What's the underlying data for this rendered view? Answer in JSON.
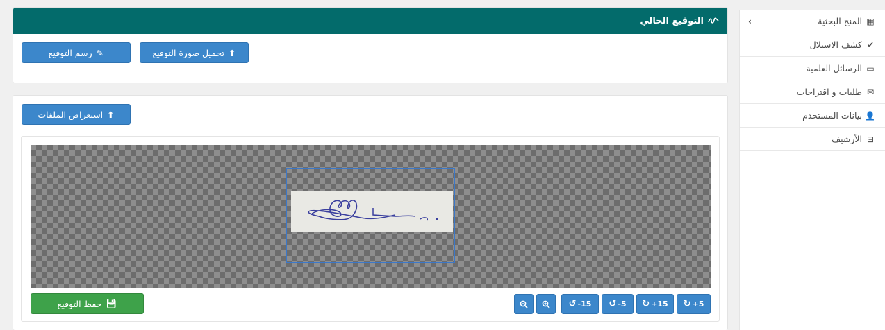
{
  "sidebar": {
    "items": [
      {
        "label": "المنح البحثية",
        "icon": "grid-icon",
        "glyph": "▦"
      },
      {
        "label": "كشف الاستلال",
        "icon": "check-double-icon",
        "glyph": "✔"
      },
      {
        "label": "الرسائل العلمية",
        "icon": "book-icon",
        "glyph": "▭"
      },
      {
        "label": "طلبات و اقتراحات",
        "icon": "envelope-icon",
        "glyph": "✉"
      },
      {
        "label": "بيانات المستخدم",
        "icon": "user-cog-icon",
        "glyph": "👤"
      },
      {
        "label": "الأرشيف",
        "icon": "archive-icon",
        "glyph": "⊟"
      }
    ],
    "collapse_glyph": "‹"
  },
  "signature_panel": {
    "title": "التوقيع الحالي",
    "title_icon": "signature-icon",
    "upload_label": "تحميل صورة التوقيع",
    "draw_label": "رسم التوقيع"
  },
  "cropper_panel": {
    "browse_label": "استعراض الملفات",
    "save_label": "حفظ التوقيع",
    "toolbar": [
      {
        "name": "zoom-out-button",
        "icon": "zoom-out-icon",
        "glyph": "🔍︎",
        "text": ""
      },
      {
        "name": "zoom-in-button",
        "icon": "zoom-in-icon",
        "glyph": "🔍︎",
        "text": ""
      },
      {
        "name": "rotate-left-15-button",
        "icon": "rotate-left-icon",
        "glyph": "↺",
        "text": "-15"
      },
      {
        "name": "rotate-left-5-button",
        "icon": "rotate-left-icon",
        "glyph": "↺",
        "text": "-5"
      },
      {
        "name": "rotate-right-15-button",
        "icon": "rotate-right-icon",
        "glyph": "↻",
        "text": "+15"
      },
      {
        "name": "rotate-right-5-button",
        "icon": "rotate-right-icon",
        "glyph": "↻",
        "text": "+5"
      }
    ]
  },
  "colors": {
    "header": "#036b6b",
    "primary": "#3c87cb",
    "success": "#3ea24a"
  }
}
